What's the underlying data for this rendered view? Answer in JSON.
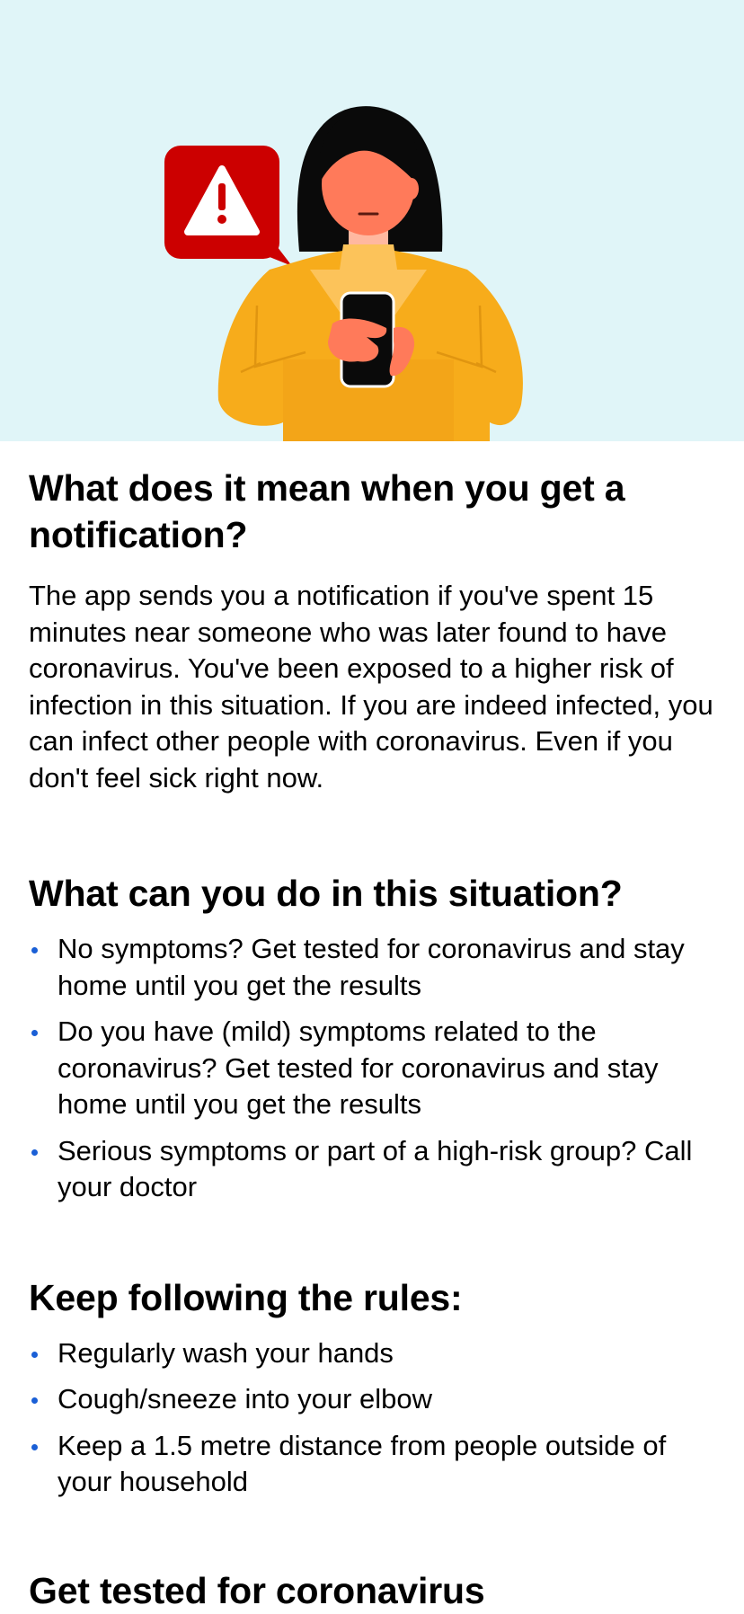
{
  "intro": {
    "title": "What does it mean when you get a notification?",
    "body": "The app sends you a notification if you've spent 15 minutes near someone who was later found to have coronavirus. You've been exposed to a higher risk of infection in this situation. If you are indeed infected, you can infect other people with coronavirus. Even if you don't feel sick right now."
  },
  "what_to_do": {
    "title": "What can you do in this situation?",
    "items": [
      "No symptoms? Get tested for coronavirus and stay home until you get the results",
      "Do you have (mild) symptoms related to the coronavirus? Get tested for coronavirus and stay home until you get the results",
      "Serious symptoms or part of a high-risk group? Call your doctor"
    ]
  },
  "rules": {
    "title": "Keep following the rules:",
    "items": [
      "Regularly wash your hands",
      "Cough/sneeze into your elbow",
      "Keep a 1.5 metre distance from people outside of your household"
    ]
  },
  "get_tested": {
    "title": "Get tested for coronavirus"
  },
  "colors": {
    "hero_background": "#e0f5f8",
    "warning_red": "#cc0000",
    "bullet_blue": "#1a5fd6",
    "sweater_yellow": "#f7ac1b"
  },
  "icons": {
    "warning": "warning-triangle-icon",
    "phone": "smartphone-icon"
  }
}
